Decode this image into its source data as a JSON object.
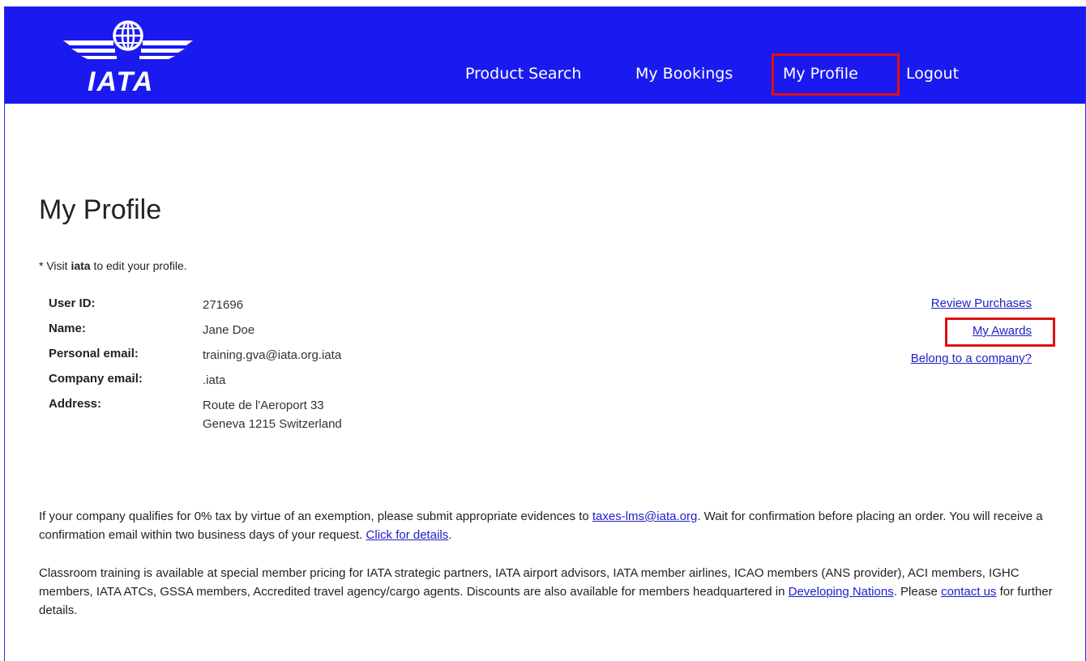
{
  "header": {
    "logo_text": "IATA",
    "nav": [
      {
        "label": "Product Search"
      },
      {
        "label": "My Bookings"
      },
      {
        "label": "My Profile"
      },
      {
        "label": "Logout"
      }
    ],
    "colors": {
      "background": "#1a1af0",
      "highlight": "#e01010"
    }
  },
  "page": {
    "title": "My Profile",
    "note_prefix": "* Visit ",
    "note_bold": "iata",
    "note_suffix": " to edit your profile."
  },
  "profile": {
    "user_id_label": "User ID:",
    "user_id": "271696",
    "name_label": "Name:",
    "name": "Jane Doe",
    "personal_email_label": "Personal email:",
    "personal_email": "training.gva@iata.org.iata",
    "company_email_label": "Company email:",
    "company_email": ".iata",
    "address_label": "Address:",
    "address_line1": "Route de l'Aeroport 33",
    "address_line2": "Geneva 1215 Switzerland"
  },
  "side_links": {
    "review_purchases": "Review Purchases",
    "my_awards": "My Awards",
    "belong_company": "Belong to a company?"
  },
  "tax_paragraph": {
    "part1": "If your company qualifies for 0% tax by virtue of an exemption, please submit appropriate evidences to ",
    "email_link": "taxes-lms@iata.org",
    "part2": ". Wait for confirmation before placing an order. You will receive a confirmation email within two business days of your request. ",
    "details_link": "Click for details",
    "part3": "."
  },
  "classroom_paragraph": {
    "part1": "Classroom training is available at special member pricing for IATA strategic partners, IATA airport advisors, IATA member airlines, ICAO members (ANS provider), ACI members, IGHC members, IATA ATCs, GSSA members, Accredited travel agency/cargo agents. Discounts are also available for members headquartered in ",
    "nations_link": "Developing Nations",
    "part2": ".  Please ",
    "contact_link": "contact us",
    "part3": " for further details."
  }
}
